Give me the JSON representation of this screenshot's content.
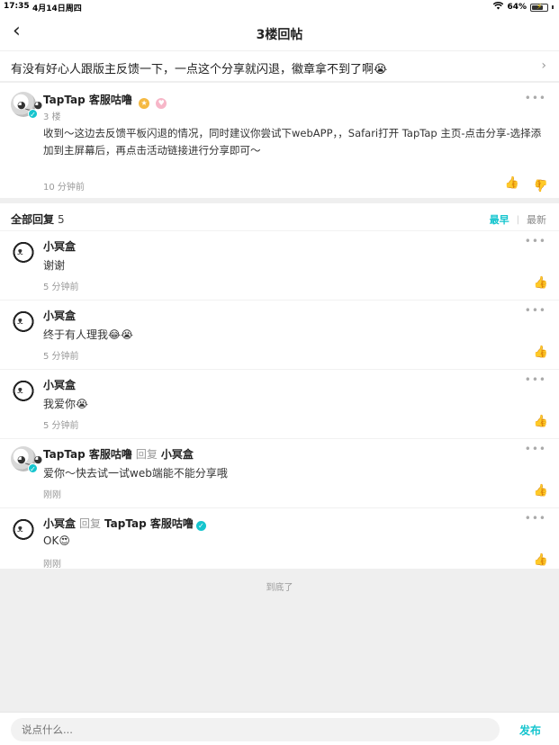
{
  "status_bar": {
    "time": "17:35",
    "date": "4月14日周四",
    "battery": "64%",
    "battery_level": 0.64
  },
  "nav": {
    "back_icon": "chevron-left-icon",
    "title": "3楼回帖"
  },
  "topic": {
    "text": "有没有好心人跟版主反馈一下，一点这个分享就闪退，徽章拿不到了啊😭",
    "chevron": "›"
  },
  "main_post": {
    "author": "TapTap 客服咕噜",
    "floor": "3 楼",
    "content": "收到～这边去反馈平板闪退的情况，同时建议你尝试下webAPP，，Safari打开 TapTap 主页-点击分享-选择添加到主屏幕后，再点击活动链接进行分享即可～",
    "time": "10 分钟前",
    "more": "•••"
  },
  "replies": {
    "header_label": "全部回复",
    "count": "5",
    "sort_active": "最早",
    "sort_sep": "|",
    "sort_inactive": "最新",
    "items": [
      {
        "author": "小冥盒",
        "reply_word": "",
        "target": "",
        "content": "谢谢",
        "time": "5 分钟前"
      },
      {
        "author": "小冥盒",
        "reply_word": "",
        "target": "",
        "content": "终于有人理我😂😭",
        "time": "5 分钟前"
      },
      {
        "author": "小冥盒",
        "reply_word": "",
        "target": "",
        "content": "我爱你😭",
        "time": "5 分钟前"
      },
      {
        "author": "TapTap 客服咕噜",
        "reply_word": "回复",
        "target": "小冥盒",
        "content": "爱你～快去试一试web端能不能分享哦",
        "time": "刚刚"
      },
      {
        "author": "小冥盒",
        "reply_word": "回复",
        "target": "TapTap 客服咕噜",
        "content": "OK😍",
        "time": "刚刚"
      }
    ]
  },
  "end_text": "到底了",
  "bottom": {
    "placeholder": "说点什么...",
    "send": "发布"
  },
  "colors": {
    "accent": "#15c5ce"
  }
}
